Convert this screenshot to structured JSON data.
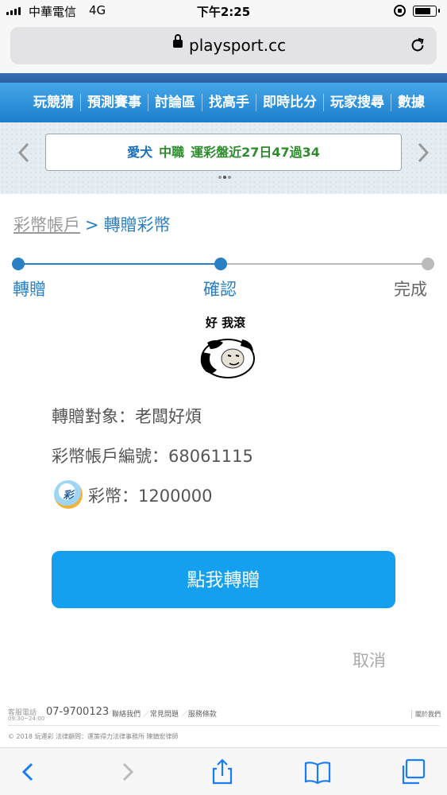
{
  "status_bar": {
    "carrier": "中華電信",
    "network": "4G",
    "time": "下午2:25",
    "battery_percent": 80
  },
  "browser": {
    "url": "playsport.cc"
  },
  "nav": {
    "items": [
      "玩競猜",
      "預測賽事",
      "討論區",
      "找高手",
      "即時比分",
      "玩家搜尋",
      "數據"
    ]
  },
  "banner": {
    "team": "愛犬",
    "league": "中職",
    "record": "運彩盤近27日47過34",
    "slide_count": 3,
    "active_slide": 2
  },
  "breadcrumb": {
    "parent": "彩幣帳戶",
    "separator": ">",
    "current": "轉贈彩幣"
  },
  "steps": [
    {
      "label": "轉贈",
      "state": "done"
    },
    {
      "label": "確認",
      "state": "current"
    },
    {
      "label": "完成",
      "state": "pending"
    }
  ],
  "meme": {
    "caption": "好 我滾"
  },
  "transfer": {
    "recipient_label": "轉贈對象：老闆好煩",
    "account_label": "彩幣帳戶編號：68061115",
    "coin_badge": "彩",
    "amount_label": "彩幣：1200000"
  },
  "actions": {
    "confirm": "點我轉贈",
    "cancel": "取消"
  },
  "footer": {
    "service_label": "客服電話",
    "service_hours": "09:30~24:00",
    "phone": "07-9700123",
    "links": [
      "聯絡我們",
      "常見問題",
      "服務條款"
    ],
    "about": "關於我們",
    "copyright": "© 2018 玩運彩 法律顧問：運策得力法律事務所 陳鎮宏律師"
  },
  "colors": {
    "accent": "#2a80c5",
    "button": "#14a0ee",
    "nav": "#1c7fcd",
    "step_pending": "#bbbbbb"
  }
}
